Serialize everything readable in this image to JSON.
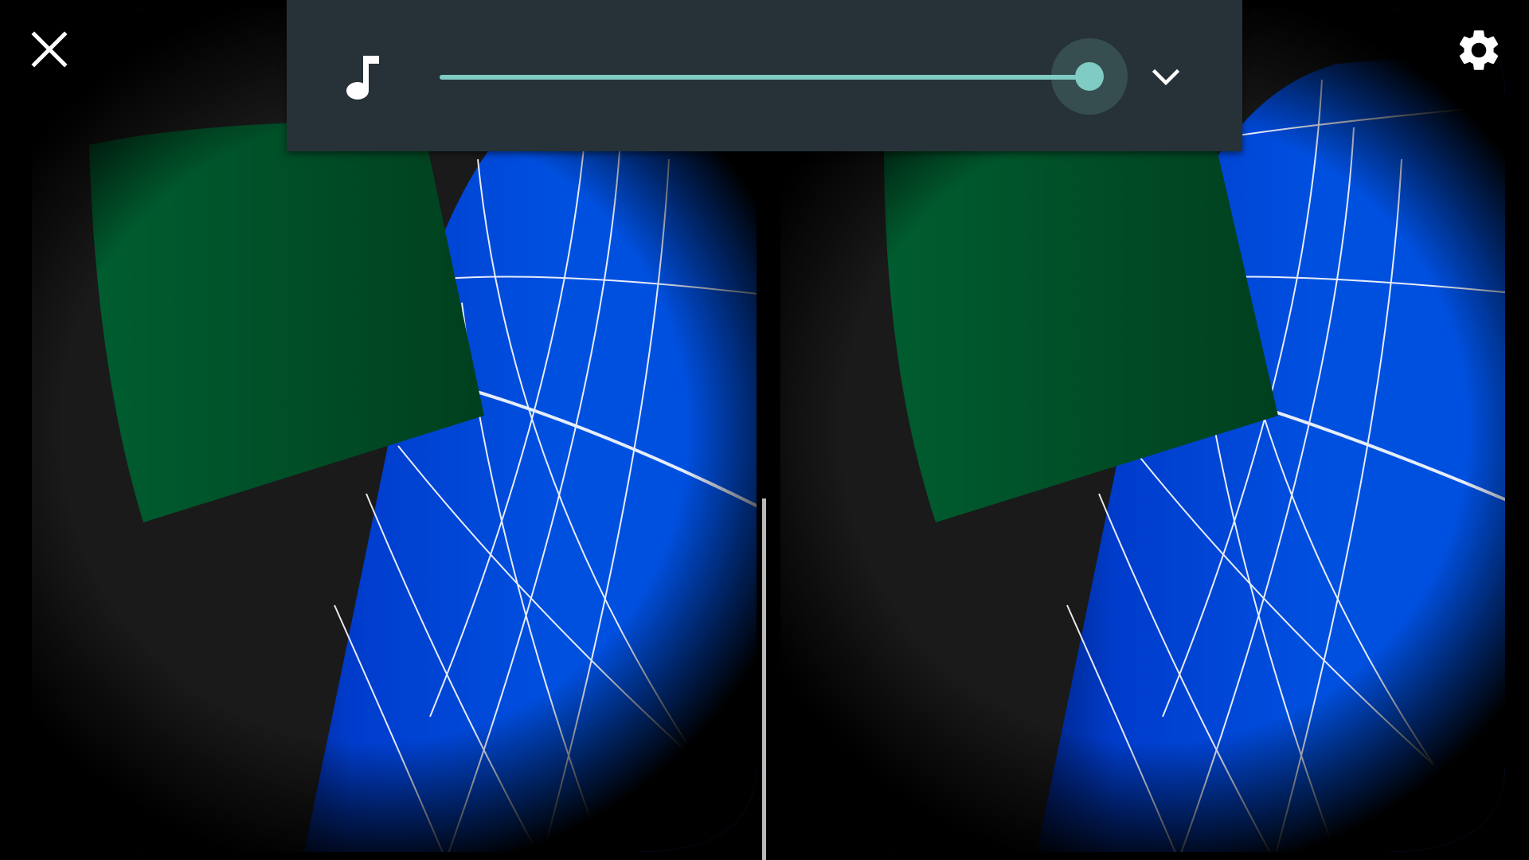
{
  "scene": {
    "background_color": "#000000",
    "sphere_color": "#0050e0",
    "sphere_grid_color": "#ffffff",
    "floor_panel_color": "#005a30",
    "void_color": "#1a1a1a",
    "divider_color": "#b9b9b9"
  },
  "top_bar": {
    "close_icon": "close-icon",
    "settings_icon": "gear-icon"
  },
  "volume_panel": {
    "background_color": "#263238",
    "accent_color": "#80cbc4",
    "music_icon": "music-note-icon",
    "expand_icon": "chevron-down-icon",
    "volume_level": 1.0
  }
}
